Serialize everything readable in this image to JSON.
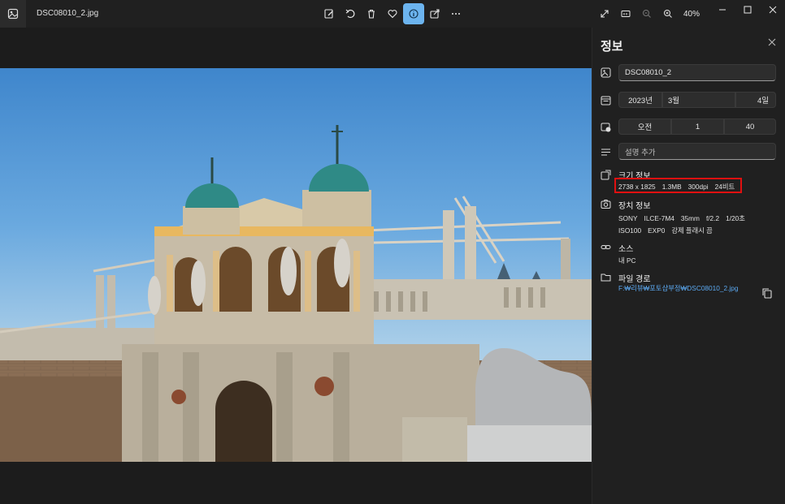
{
  "titlebar": {
    "file_name": "DSC08010_2.jpg",
    "zoom": "40%"
  },
  "toolbar": {
    "items": [
      "edit-icon",
      "rotate-icon",
      "delete-icon",
      "favorite-icon",
      "info-icon",
      "share-icon",
      "more-icon"
    ],
    "active": "info-icon"
  },
  "right_tools": [
    "fullscreen-icon",
    "actual-size-icon",
    "zoom-out-icon",
    "zoom-in-icon"
  ],
  "window": [
    "minimize-icon",
    "maximize-icon",
    "close-icon"
  ],
  "panel": {
    "title": "정보",
    "file_title": "DSC08010_2",
    "date": {
      "year": "2023년",
      "month": "3월",
      "day": "4일"
    },
    "time": {
      "ampm": "오전",
      "hour": "1",
      "minute": "40"
    },
    "description_placeholder": "설명 추가",
    "size_info": {
      "title": "크기 정보",
      "dimensions": "2738 x 1825",
      "filesize": "1.3MB",
      "dpi": "300dpi",
      "bits": "24비트"
    },
    "device_info": {
      "title": "장치 정보",
      "line1": [
        "SONY",
        "ILCE-7M4",
        "35mm",
        "f/2.2",
        "1/20초"
      ],
      "line2": [
        "ISO100",
        "EXP0",
        "강제 플래시 끔"
      ]
    },
    "source": {
      "title": "소스",
      "value": "내 PC"
    },
    "file_path": {
      "title": "파일 경로",
      "value": "F:₩리뷰₩포토샵부정₩DSC08010_2.jpg"
    }
  },
  "colors": {
    "accent": "#6cb4ef",
    "link": "#5ba8f0",
    "highlight": "#e01010"
  }
}
